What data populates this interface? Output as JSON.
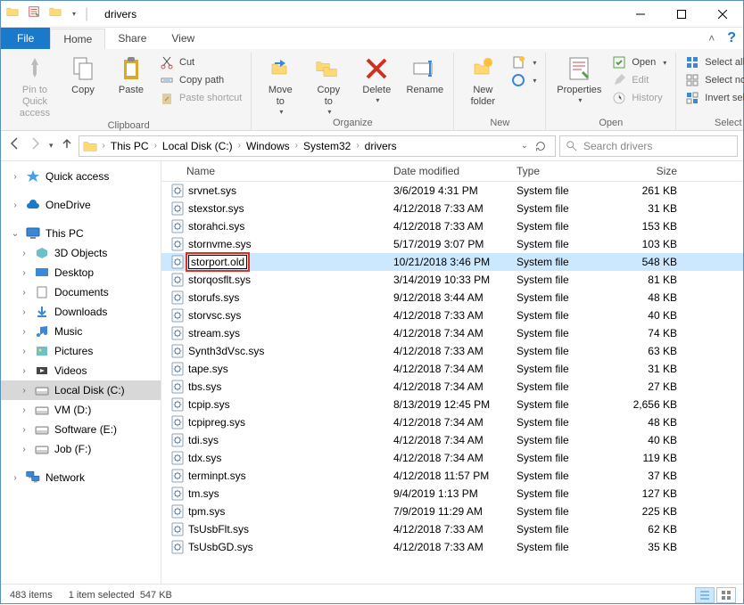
{
  "window": {
    "title": "drivers"
  },
  "tabs": {
    "file": "File",
    "home": "Home",
    "share": "Share",
    "view": "View"
  },
  "ribbon": {
    "clipboard": {
      "label": "Clipboard",
      "pin": "Pin to Quick\naccess",
      "copy": "Copy",
      "paste": "Paste",
      "cut": "Cut",
      "copypath": "Copy path",
      "pasteshortcut": "Paste shortcut"
    },
    "organize": {
      "label": "Organize",
      "moveto": "Move\nto",
      "copyto": "Copy\nto",
      "delete": "Delete",
      "rename": "Rename"
    },
    "new": {
      "label": "New",
      "newfolder": "New\nfolder"
    },
    "open": {
      "label": "Open",
      "properties": "Properties",
      "open": "Open",
      "edit": "Edit",
      "history": "History"
    },
    "select": {
      "label": "Select",
      "all": "Select all",
      "none": "Select none",
      "invert": "Invert selection"
    }
  },
  "breadcrumb": {
    "items": [
      "This PC",
      "Local Disk (C:)",
      "Windows",
      "System32",
      "drivers"
    ]
  },
  "search": {
    "placeholder": "Search drivers"
  },
  "columns": {
    "name": "Name",
    "date": "Date modified",
    "type": "Type",
    "size": "Size"
  },
  "navpane": {
    "quick": "Quick access",
    "onedrive": "OneDrive",
    "thispc": "This PC",
    "objects3d": "3D Objects",
    "desktop": "Desktop",
    "documents": "Documents",
    "downloads": "Downloads",
    "music": "Music",
    "pictures": "Pictures",
    "videos": "Videos",
    "cdisk": "Local Disk (C:)",
    "vm": "VM (D:)",
    "software": "Software (E:)",
    "job": "Job (F:)",
    "network": "Network"
  },
  "files": [
    {
      "name": "srvnet.sys",
      "date": "3/6/2019 4:31 PM",
      "type": "System file",
      "size": "261 KB"
    },
    {
      "name": "stexstor.sys",
      "date": "4/12/2018 7:33 AM",
      "type": "System file",
      "size": "31 KB"
    },
    {
      "name": "storahci.sys",
      "date": "4/12/2018 7:33 AM",
      "type": "System file",
      "size": "153 KB"
    },
    {
      "name": "stornvme.sys",
      "date": "5/17/2019 3:07 PM",
      "type": "System file",
      "size": "103 KB"
    },
    {
      "name": "storport.old",
      "date": "10/21/2018 3:46 PM",
      "type": "System file",
      "size": "548 KB",
      "selected": true,
      "renaming": true
    },
    {
      "name": "storqosflt.sys",
      "date": "3/14/2019 10:33 PM",
      "type": "System file",
      "size": "81 KB"
    },
    {
      "name": "storufs.sys",
      "date": "9/12/2018 3:44 AM",
      "type": "System file",
      "size": "48 KB"
    },
    {
      "name": "storvsc.sys",
      "date": "4/12/2018 7:33 AM",
      "type": "System file",
      "size": "40 KB"
    },
    {
      "name": "stream.sys",
      "date": "4/12/2018 7:34 AM",
      "type": "System file",
      "size": "74 KB"
    },
    {
      "name": "Synth3dVsc.sys",
      "date": "4/12/2018 7:33 AM",
      "type": "System file",
      "size": "63 KB"
    },
    {
      "name": "tape.sys",
      "date": "4/12/2018 7:34 AM",
      "type": "System file",
      "size": "31 KB"
    },
    {
      "name": "tbs.sys",
      "date": "4/12/2018 7:34 AM",
      "type": "System file",
      "size": "27 KB"
    },
    {
      "name": "tcpip.sys",
      "date": "8/13/2019 12:45 PM",
      "type": "System file",
      "size": "2,656 KB"
    },
    {
      "name": "tcpipreg.sys",
      "date": "4/12/2018 7:34 AM",
      "type": "System file",
      "size": "48 KB"
    },
    {
      "name": "tdi.sys",
      "date": "4/12/2018 7:34 AM",
      "type": "System file",
      "size": "40 KB"
    },
    {
      "name": "tdx.sys",
      "date": "4/12/2018 7:34 AM",
      "type": "System file",
      "size": "119 KB"
    },
    {
      "name": "terminpt.sys",
      "date": "4/12/2018 11:57 PM",
      "type": "System file",
      "size": "37 KB"
    },
    {
      "name": "tm.sys",
      "date": "9/4/2019 1:13 PM",
      "type": "System file",
      "size": "127 KB"
    },
    {
      "name": "tpm.sys",
      "date": "7/9/2019 11:29 AM",
      "type": "System file",
      "size": "225 KB"
    },
    {
      "name": "TsUsbFlt.sys",
      "date": "4/12/2018 7:33 AM",
      "type": "System file",
      "size": "62 KB"
    },
    {
      "name": "TsUsbGD.sys",
      "date": "4/12/2018 7:33 AM",
      "type": "System file",
      "size": "35 KB"
    }
  ],
  "status": {
    "items": "483 items",
    "selected": "1 item selected",
    "size": "547 KB"
  }
}
